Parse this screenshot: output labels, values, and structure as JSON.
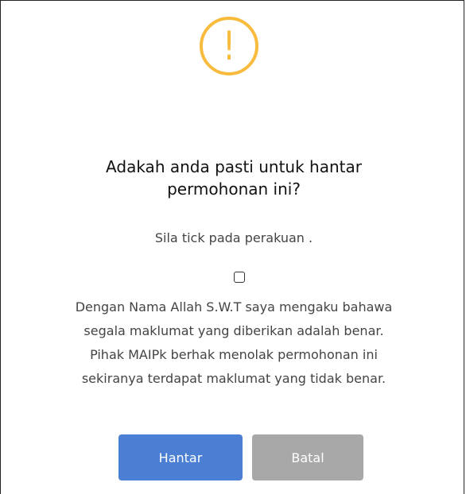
{
  "dialog": {
    "icon": "warning-exclamation-icon",
    "icon_glyph": "!",
    "icon_color": "#f8bb3d",
    "title_line1": "Adakah anda pasti untuk hantar",
    "title_line2": "permohonan ini?",
    "subtitle": "Sila tick pada perakuan .",
    "checkbox_checked": false,
    "declaration_lines": [
      "Dengan Nama Allah S.W.T saya mengaku bahawa",
      "segala maklumat yang diberikan adalah benar.",
      "Pihak MAIPk berhak menolak permohonan ini",
      "sekiranya terdapat maklumat yang tidak benar."
    ],
    "submit_label": "Hantar",
    "cancel_label": "Batal",
    "submit_color": "#4a7fd3",
    "cancel_color": "#a8a8a8"
  }
}
